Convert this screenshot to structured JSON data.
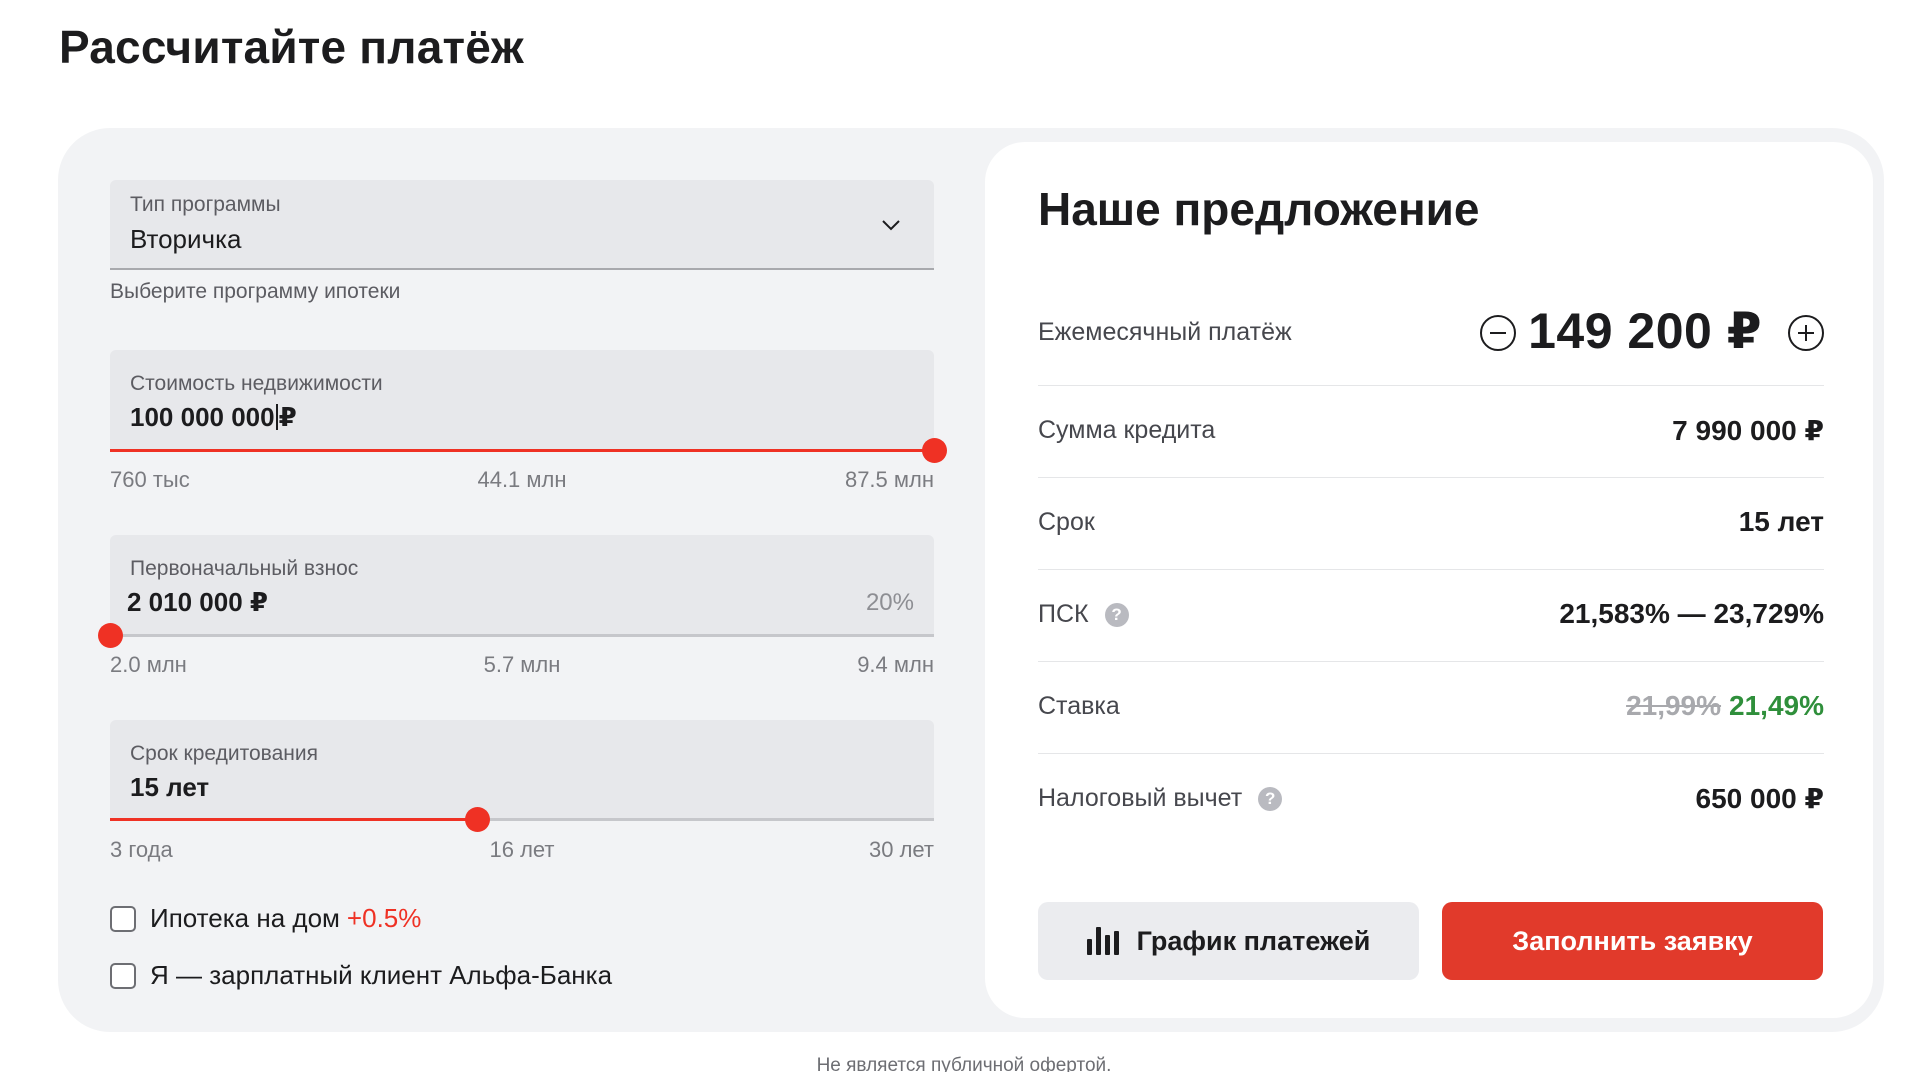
{
  "page": {
    "title": "Рассчитайте платёж",
    "disclaimer": "Не является публичной офертой."
  },
  "program": {
    "label": "Тип программы",
    "value": "Вторичка",
    "hint": "Выберите программу ипотеки",
    "icon": "chevron-down-icon"
  },
  "property_cost": {
    "label": "Стоимость недвижимости",
    "value": "100 000 000",
    "currency": "₽",
    "slider_fraction": 1.0,
    "ticks": [
      "760 тыс",
      "44.1 млн",
      "87.5 млн"
    ]
  },
  "down_payment": {
    "label": "Первоначальный взнос",
    "value": "2 010 000",
    "currency": "₽",
    "percent": "20%",
    "slider_fraction": 0.0,
    "ticks": [
      "2.0 млн",
      "5.7 млн",
      "9.4 млн"
    ]
  },
  "term": {
    "label": "Срок кредитования",
    "value": "15 лет",
    "slider_fraction": 0.445,
    "ticks": [
      "3 года",
      "16 лет",
      "30 лет"
    ]
  },
  "options": [
    {
      "label": "Ипотека на дом",
      "extra": "+0.5%",
      "checked": false
    },
    {
      "label": "Я — зарплатный клиент Альфа-Банка",
      "extra": "",
      "checked": false
    }
  ],
  "offer": {
    "title": "Наше предложение",
    "monthly": {
      "label": "Ежемесячный платёж",
      "value": "149 200 ₽"
    },
    "loan_sum": {
      "label": "Сумма кредита",
      "value": "7 990 000 ₽"
    },
    "term": {
      "label": "Срок",
      "value": "15 лет"
    },
    "psk": {
      "label": "ПСК",
      "value": "21,583% — 23,729%"
    },
    "rate": {
      "label": "Ставка",
      "old_value": "21,99%",
      "new_value": "21,49%"
    },
    "tax": {
      "label": "Налоговый вычет",
      "value": "650 000 ₽"
    },
    "help_glyph": "?",
    "schedule_button": "График платежей",
    "apply_button": "Заполнить заявку"
  },
  "colors": {
    "accent": "#ef3124",
    "apply_button": "#e13a2b",
    "rate_new": "#2f8f3b",
    "card_background": "#f2f3f5"
  }
}
